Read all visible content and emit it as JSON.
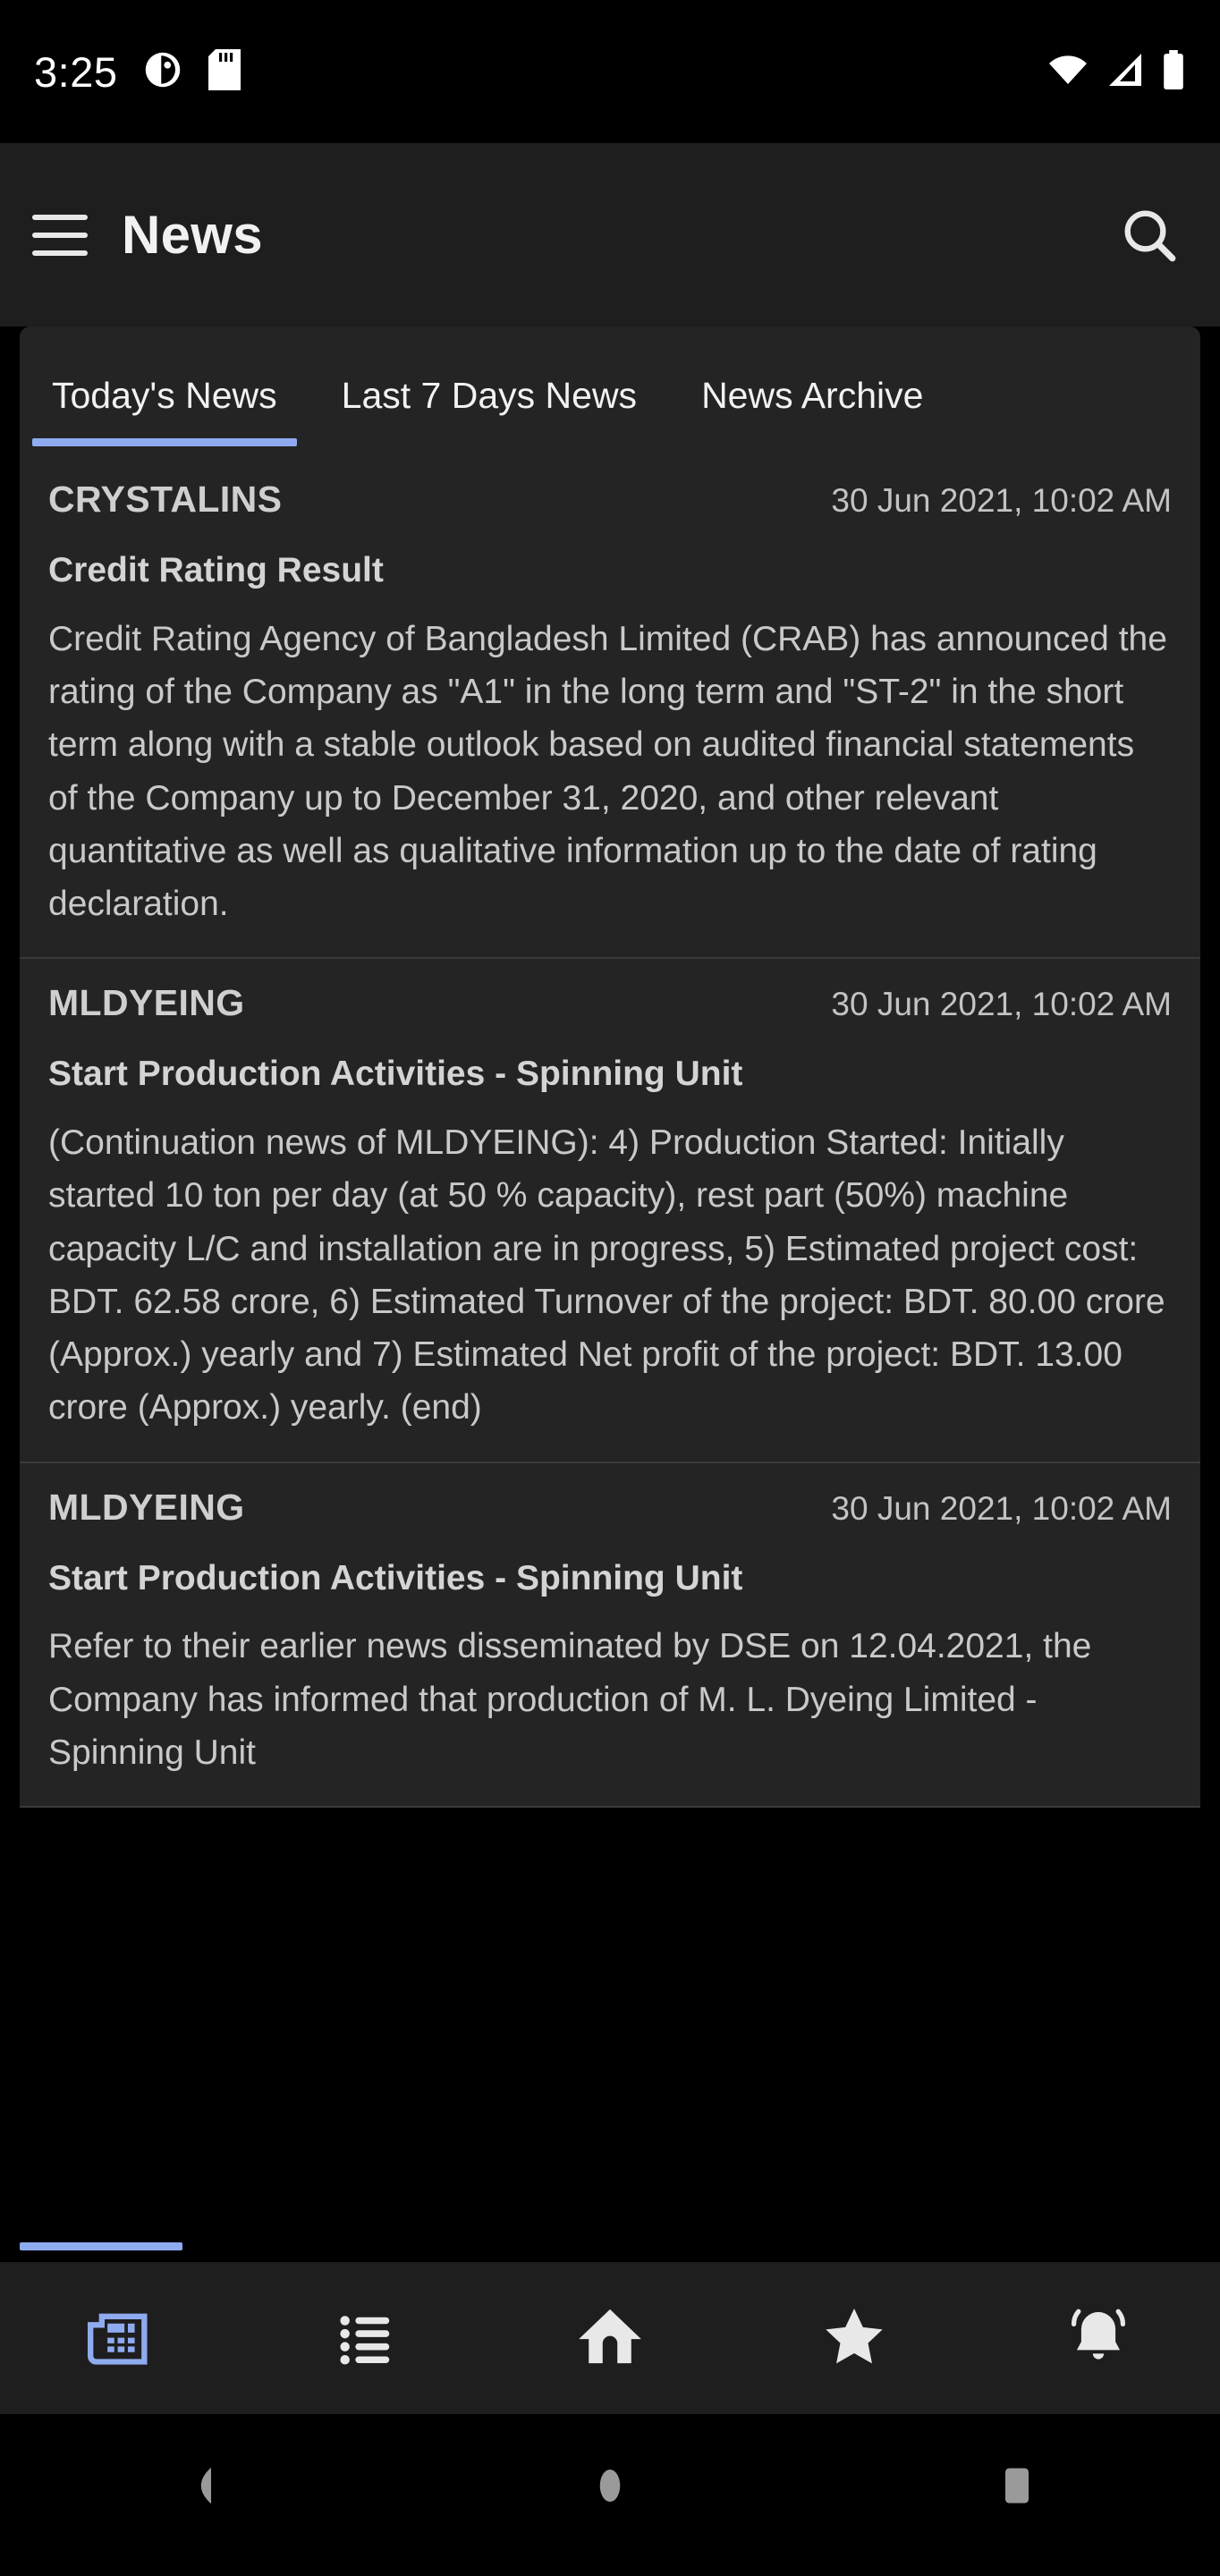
{
  "status_bar": {
    "time": "3:25",
    "left_icons": [
      "do-not-disturb-icon",
      "sd-card-icon"
    ],
    "right_icons": [
      "wifi-icon",
      "cellular-signal-icon",
      "battery-icon"
    ]
  },
  "app_bar": {
    "menu_icon": "hamburger-menu-icon",
    "title": "News",
    "search_icon": "search-icon"
  },
  "tabs": {
    "active_index": 0,
    "items": [
      {
        "label": "Today's News"
      },
      {
        "label": "Last 7 Days News"
      },
      {
        "label": "News Archive"
      }
    ]
  },
  "news": {
    "items": [
      {
        "company": "CRYSTALINS",
        "date": "30 Jun 2021, 10:02 AM",
        "title": "Credit Rating Result",
        "body": "Credit Rating Agency of Bangladesh Limited (CRAB) has announced the rating of the Company as \"A1\" in the long term and \"ST-2\" in the short term along with a stable outlook based on audited financial statements of the Company up to December 31, 2020, and other relevant quantitative as well as qualitative information up to the date of rating declaration."
      },
      {
        "company": "MLDYEING",
        "date": "30 Jun 2021, 10:02 AM",
        "title": "Start Production Activities - Spinning Unit",
        "body": "(Continuation news of MLDYEING): 4) Production Started: Initially started 10 ton per day (at 50 % capacity), rest part (50%) machine capacity L/C and installation are in progress, 5) Estimated project cost: BDT. 62.58 crore, 6) Estimated Turnover of the project: BDT. 80.00 crore (Approx.) yearly and 7) Estimated Net profit of the project: BDT. 13.00 crore (Approx.) yearly. (end)"
      },
      {
        "company": "MLDYEING",
        "date": "30 Jun 2021, 10:02 AM",
        "title": "Start Production Activities - Spinning Unit",
        "body": "Refer to their earlier news disseminated by DSE on 12.04.2021, the Company has informed that production of M. L. Dyeing Limited - Spinning Unit"
      }
    ]
  },
  "bottom_nav": {
    "active_index": 0,
    "items": [
      {
        "icon": "newspaper-icon"
      },
      {
        "icon": "list-icon"
      },
      {
        "icon": "home-icon"
      },
      {
        "icon": "star-icon"
      },
      {
        "icon": "notification-bell-icon"
      }
    ]
  },
  "system_nav": {
    "items": [
      {
        "icon": "back-triangle-icon"
      },
      {
        "icon": "home-circle-icon"
      },
      {
        "icon": "recents-square-icon"
      }
    ]
  },
  "colors": {
    "accent": "#8fabf0",
    "surface": "#242424",
    "app_bar": "#1e1e1e",
    "background": "#000000",
    "text_primary": "#f1f1f1",
    "text_secondary": "#c9c9c9"
  }
}
